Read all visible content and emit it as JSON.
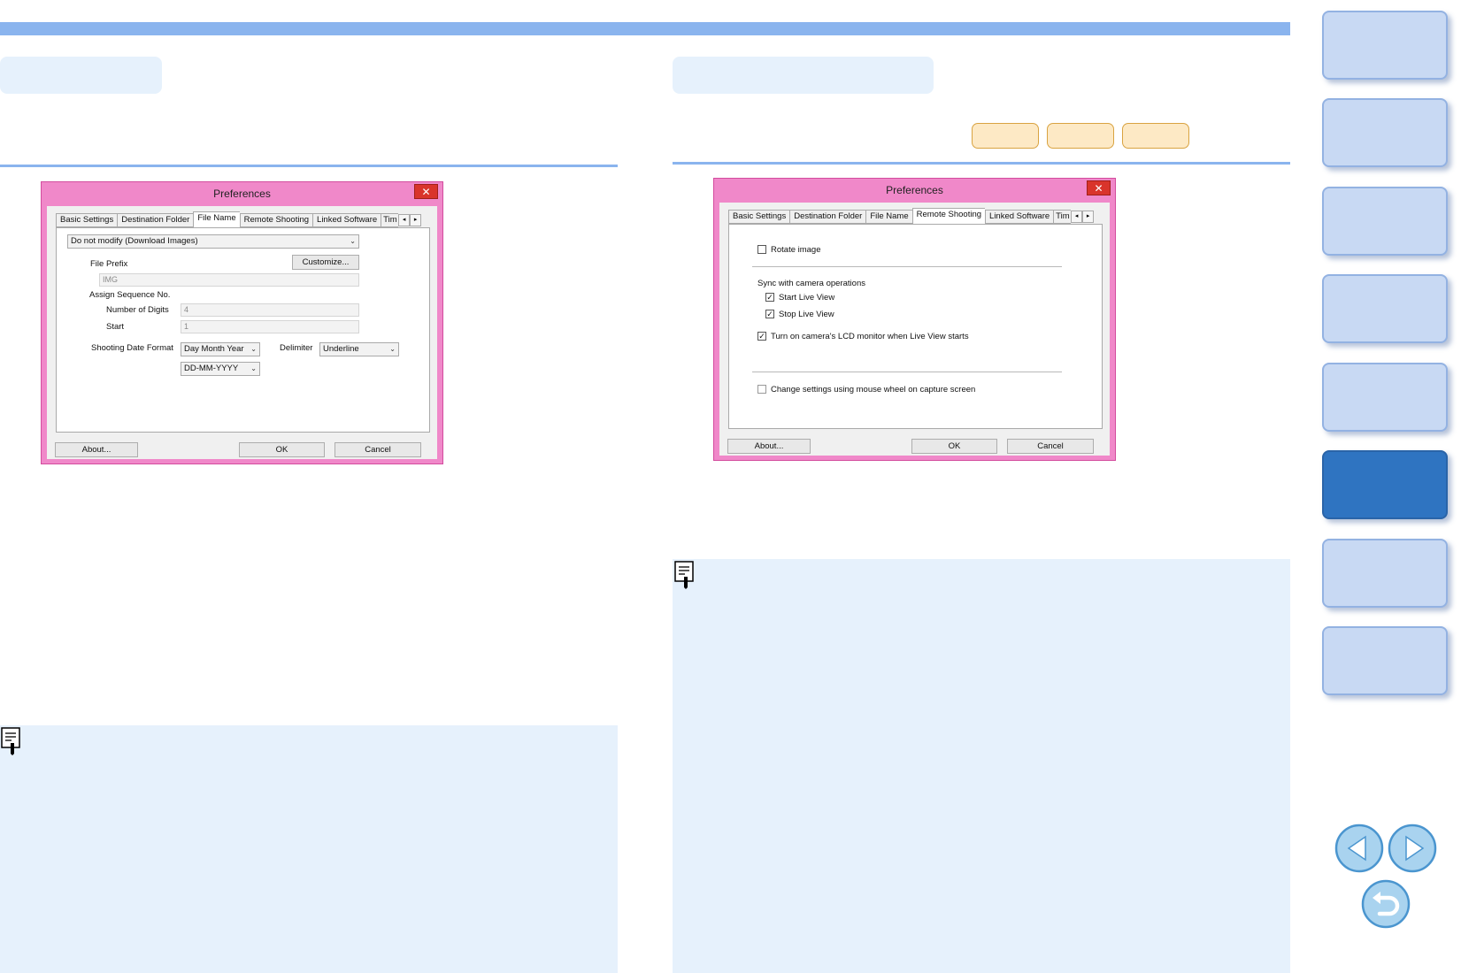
{
  "colors": {
    "accent_blue": "#8ab4ee",
    "header_fill": "#e6f1fc",
    "dialog_frame": "#f088c9",
    "close_red": "#d9342b",
    "tag_fill": "#fde9c5",
    "tag_border": "#d9a341",
    "nav_active": "#2f74c1",
    "nav_inactive": "#c8d9f3"
  },
  "left_dialog": {
    "title": "Preferences",
    "close_glyph": "✕",
    "tabs": [
      "Basic Settings",
      "Destination Folder",
      "File Name",
      "Remote Shooting",
      "Linked Software",
      "Tim"
    ],
    "active_tab": "File Name",
    "scroll_left": "◂",
    "scroll_right": "▸",
    "mode_select": "Do not modify (Download Images)",
    "file_prefix_label": "File Prefix",
    "customize_button": "Customize...",
    "prefix_value": "IMG",
    "assign_sequence_label": "Assign Sequence No.",
    "digits_label": "Number of Digits",
    "digits_value": "4",
    "start_label": "Start",
    "start_value": "1",
    "date_format_label": "Shooting Date Format",
    "date_format_select": "Day Month Year",
    "delimiter_label": "Delimiter",
    "delimiter_select": "Underline",
    "date_pattern_select": "DD-MM-YYYY",
    "about_button": "About...",
    "ok_button": "OK",
    "cancel_button": "Cancel",
    "caret": "⌄"
  },
  "right_dialog": {
    "title": "Preferences",
    "close_glyph": "✕",
    "tabs": [
      "Basic Settings",
      "Destination Folder",
      "File Name",
      "Remote Shooting",
      "Linked Software",
      "Tim"
    ],
    "active_tab": "Remote Shooting",
    "scroll_left": "◂",
    "scroll_right": "▸",
    "rotate_image_label": "Rotate image",
    "rotate_image_checked": false,
    "sync_heading": "Sync with camera operations",
    "start_live_view_label": "Start Live View",
    "start_live_view_checked": true,
    "stop_live_view_label": "Stop Live View",
    "stop_live_view_checked": true,
    "lcd_monitor_label": "Turn on camera's LCD monitor when Live View starts",
    "lcd_monitor_checked": true,
    "mouse_wheel_label": "Change settings using mouse wheel on capture screen",
    "mouse_wheel_checked": false,
    "check_glyph": "✓",
    "about_button": "About...",
    "ok_button": "OK",
    "cancel_button": "Cancel"
  },
  "nav": {
    "sections": 8,
    "active_index": 5,
    "prev_icon": "arrow-left-icon",
    "next_icon": "arrow-right-icon",
    "back_icon": "return-icon"
  }
}
